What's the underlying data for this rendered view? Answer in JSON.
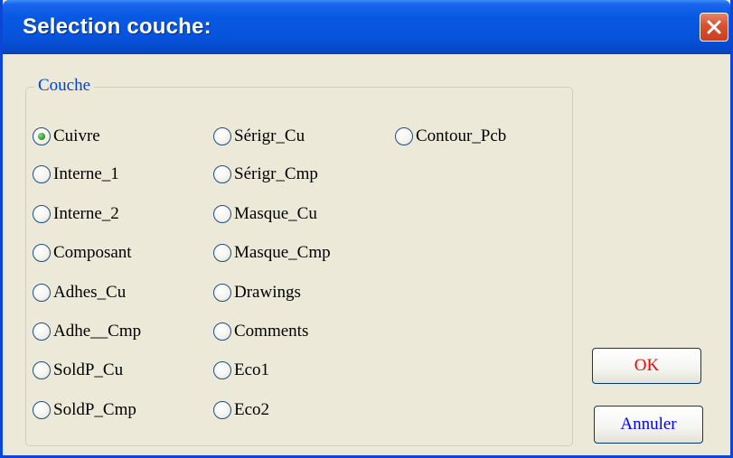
{
  "window": {
    "title": "Selection couche:"
  },
  "group": {
    "legend": "Couche"
  },
  "layers": {
    "selected": "Cuivre",
    "col1": [
      "Cuivre",
      "Interne_1",
      "Interne_2",
      "Composant",
      "Adhes_Cu",
      "Adhe__Cmp",
      "SoldP_Cu",
      "SoldP_Cmp"
    ],
    "col2": [
      "Sérigr_Cu",
      "Sérigr_Cmp",
      "Masque_Cu",
      "Masque_Cmp",
      "Drawings",
      "Comments",
      "Eco1",
      "Eco2"
    ],
    "col3": [
      "Contour_Pcb"
    ]
  },
  "buttons": {
    "ok_label": "OK",
    "cancel_label": "Annuler"
  },
  "colors": {
    "ok_text": "#ff0000",
    "cancel_text": "#0000ff",
    "legend_text": "#0046d5",
    "title_bar": "#0753dc"
  },
  "icons": {
    "close": "close-icon",
    "radio_selected": "radio-selected-icon",
    "radio_unselected": "radio-unselected-icon"
  }
}
